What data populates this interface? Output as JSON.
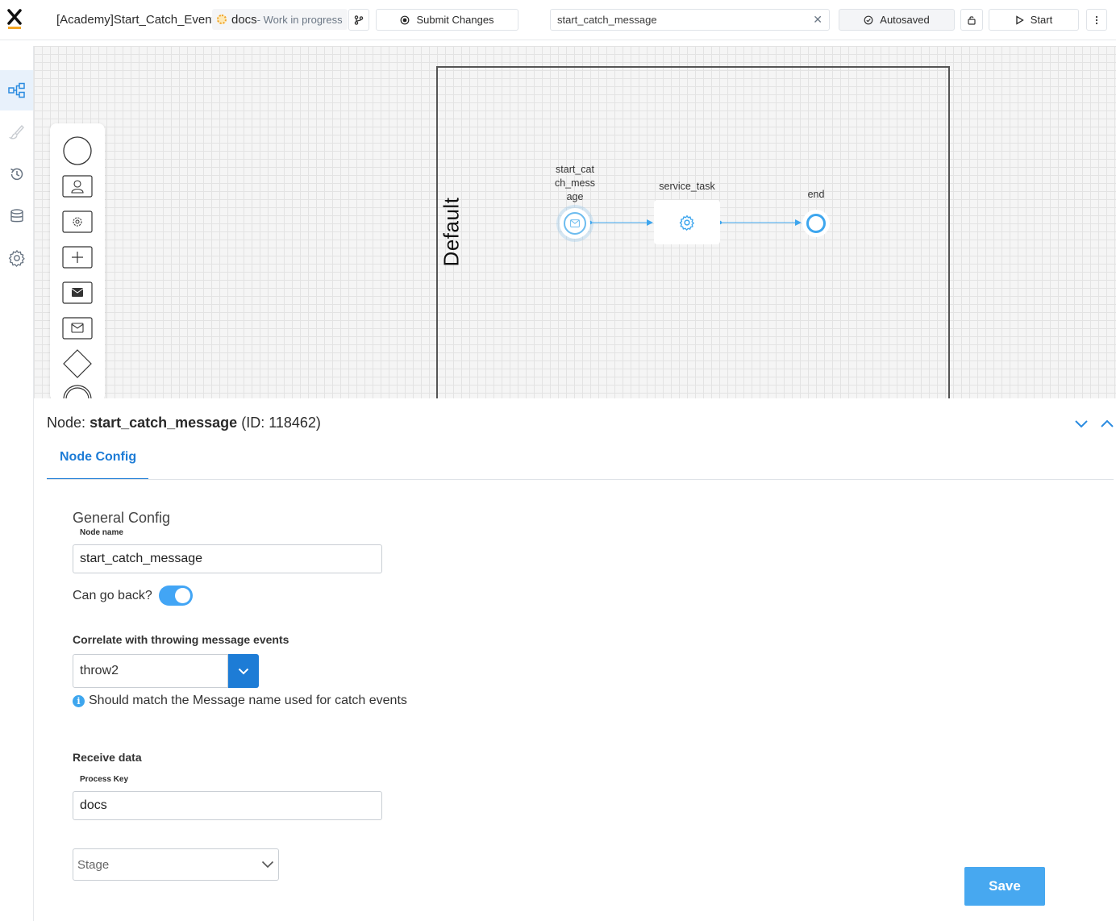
{
  "header": {
    "process_title": "[Academy]Start_Catch_Event",
    "branch_name": "docs",
    "branch_status": "- Work in progress",
    "submit_label": "Submit Changes",
    "search_value": "start_catch_message",
    "autosaved_label": "Autosaved",
    "start_label": "Start"
  },
  "diagram": {
    "lane_label": "Default",
    "nodes": [
      {
        "label": "start_catch_message",
        "label_lines": [
          "start_cat",
          "ch_mess",
          "age"
        ],
        "type": "message-start-event"
      },
      {
        "label": "service_task",
        "type": "service-task"
      },
      {
        "label": "end",
        "type": "end-event"
      }
    ]
  },
  "panel": {
    "node_prefix": "Node:",
    "node_name": "start_catch_message",
    "node_id": "(ID: 118462)",
    "tab_label": "Node Config",
    "general_config_title": "General Config",
    "node_name_label": "Node name",
    "node_name_value": "start_catch_message",
    "can_go_back_label": "Can go back?",
    "can_go_back": true,
    "correlate_label": "Correlate with throwing message events",
    "correlate_value": "throw2",
    "correlate_hint": "Should match the Message name used for catch events",
    "receive_data_label": "Receive data",
    "process_key_label": "Process Key",
    "process_key_value": "docs",
    "stage_placeholder": "Stage",
    "save_label": "Save"
  },
  "colors": {
    "accent": "#1d7cd6",
    "accent_light": "#47a8f0",
    "node_blue": "#3ea6ee",
    "branch_status_dot": "#f0a32a"
  }
}
